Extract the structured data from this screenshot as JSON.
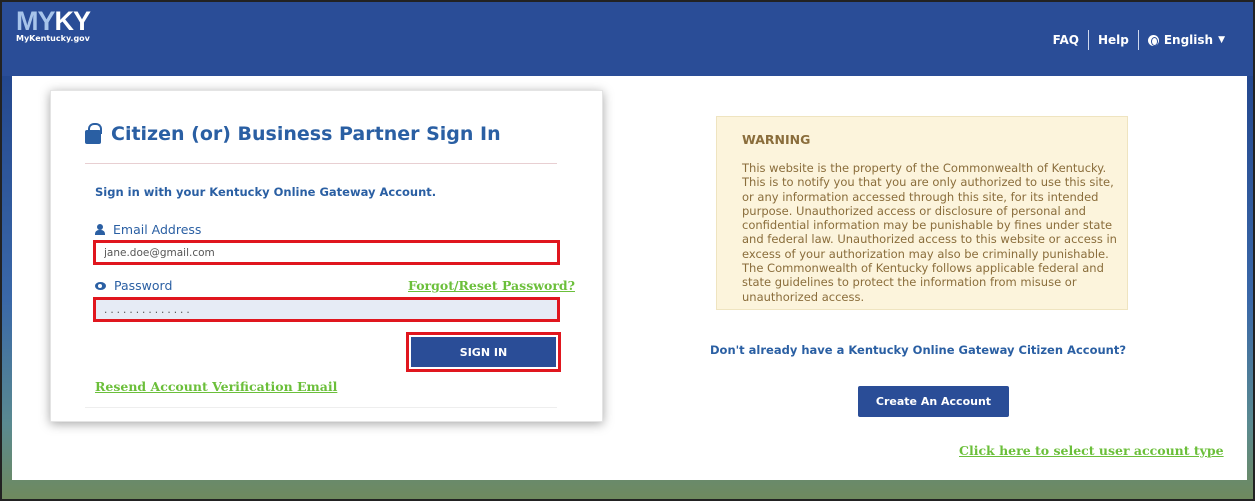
{
  "header": {
    "logo_my": "MY",
    "logo_ky": "KY",
    "logo_sub": "MyKentucky.gov",
    "nav": {
      "faq": "FAQ",
      "help": "Help",
      "language": "English"
    }
  },
  "signin": {
    "title": "Citizen (or) Business Partner Sign In",
    "subtitle": "Sign in with your Kentucky Online Gateway Account.",
    "email_label": "Email Address",
    "email_value": "jane.doe@gmail.com",
    "password_label": "Password",
    "password_value": "..............",
    "forgot_link": "Forgot/Reset Password?",
    "signin_button": "SIGN IN",
    "resend_link": "Resend Account Verification Email"
  },
  "warning": {
    "title": "WARNING",
    "text": "This website is the property of the Commonwealth of Kentucky. This is to notify you that you are only authorized to use this site, or any information accessed through this site, for its intended purpose. Unauthorized access or disclosure of personal and confidential information may be punishable by fines under state and federal law. Unauthorized access to this website or access in excess of your authorization may also be criminally punishable. The Commonwealth of Kentucky follows applicable federal and state guidelines to protect the information from misuse or unauthorized access."
  },
  "register": {
    "prompt": "Don't already have a Kentucky Online Gateway Citizen Account?",
    "create_button": "Create An Account",
    "select_type_link": "Click here to select user account type"
  },
  "colors": {
    "header_blue": "#2a4d97",
    "link_green": "#6bbf3a",
    "highlight_red": "#e0161e",
    "warning_bg": "#fcf4dc"
  }
}
